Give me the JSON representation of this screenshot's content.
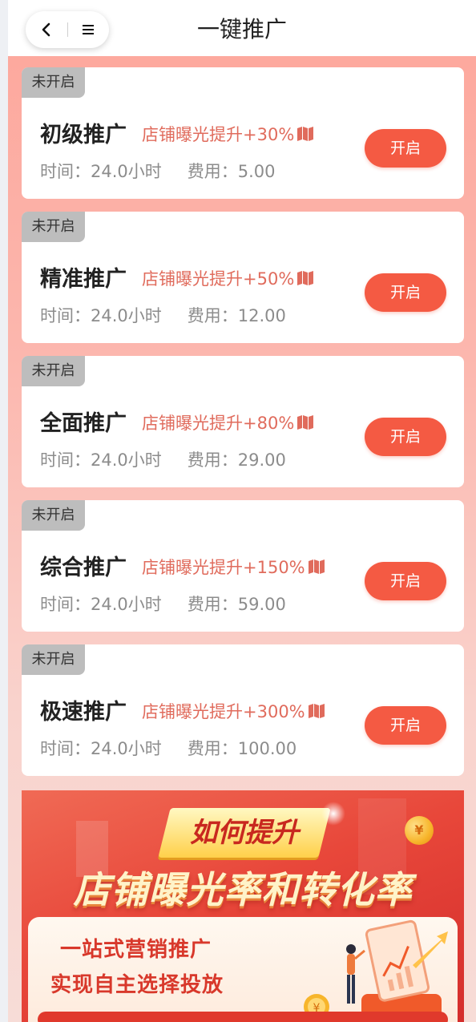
{
  "header": {
    "title": "一键推广",
    "back_icon": "chevron-left-icon",
    "menu_icon": "menu-icon"
  },
  "cards": [
    {
      "status": "未开启",
      "name": "初级推广",
      "boost": "店铺曝光提升+30%",
      "time": "时间：24.0小时",
      "fee": "费用：5.00",
      "button": "开启"
    },
    {
      "status": "未开启",
      "name": "精准推广",
      "boost": "店铺曝光提升+50%",
      "time": "时间：24.0小时",
      "fee": "费用：12.00",
      "button": "开启"
    },
    {
      "status": "未开启",
      "name": "全面推广",
      "boost": "店铺曝光提升+80%",
      "time": "时间：24.0小时",
      "fee": "费用：29.00",
      "button": "开启"
    },
    {
      "status": "未开启",
      "name": "综合推广",
      "boost": "店铺曝光提升+150%",
      "time": "时间：24.0小时",
      "fee": "费用：59.00",
      "button": "开启"
    },
    {
      "status": "未开启",
      "name": "极速推广",
      "boost": "店铺曝光提升+300%",
      "time": "时间：24.0小时",
      "fee": "费用：100.00",
      "button": "开启"
    }
  ],
  "banner": {
    "ribbon": "如何提升",
    "headline": "店铺曝光率和转化率",
    "line1": "一站式营销推广",
    "line2": "实现自主选择投放",
    "coin_symbol": "¥"
  },
  "colors": {
    "accent": "#f45a43",
    "boost_text": "#e06b5c",
    "badge_bg": "#bdbdbd"
  }
}
